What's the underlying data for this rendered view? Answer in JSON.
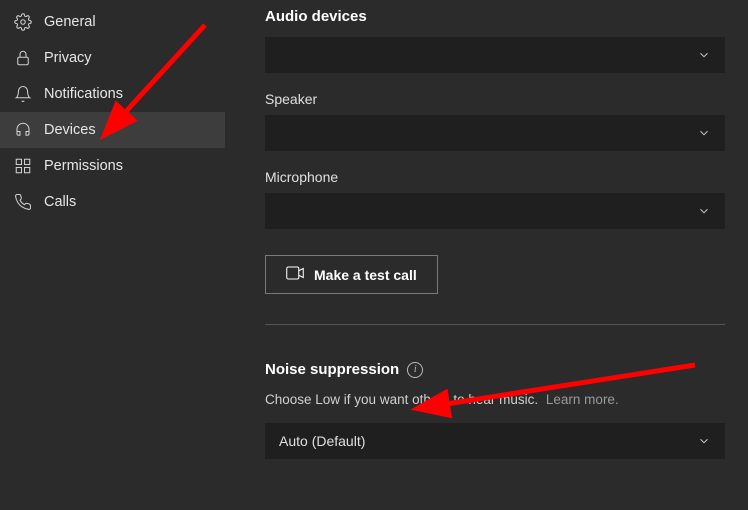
{
  "sidebar": {
    "items": [
      {
        "label": "General",
        "icon": "gear-icon"
      },
      {
        "label": "Privacy",
        "icon": "lock-icon"
      },
      {
        "label": "Notifications",
        "icon": "bell-icon"
      },
      {
        "label": "Devices",
        "icon": "headset-icon",
        "active": true
      },
      {
        "label": "Permissions",
        "icon": "grid-icon"
      },
      {
        "label": "Calls",
        "icon": "phone-icon"
      }
    ]
  },
  "audio": {
    "section_title": "Audio devices",
    "device_value": "",
    "speaker_label": "Speaker",
    "speaker_value": "",
    "mic_label": "Microphone",
    "mic_value": "",
    "test_call_label": "Make a test call"
  },
  "noise": {
    "section_title": "Noise suppression",
    "description": "Choose Low if you want others to hear music.",
    "learn_more": "Learn more.",
    "value": "Auto (Default)"
  },
  "annotations": {
    "arrow_to_devices": true,
    "arrow_to_noise_suppression": true
  }
}
